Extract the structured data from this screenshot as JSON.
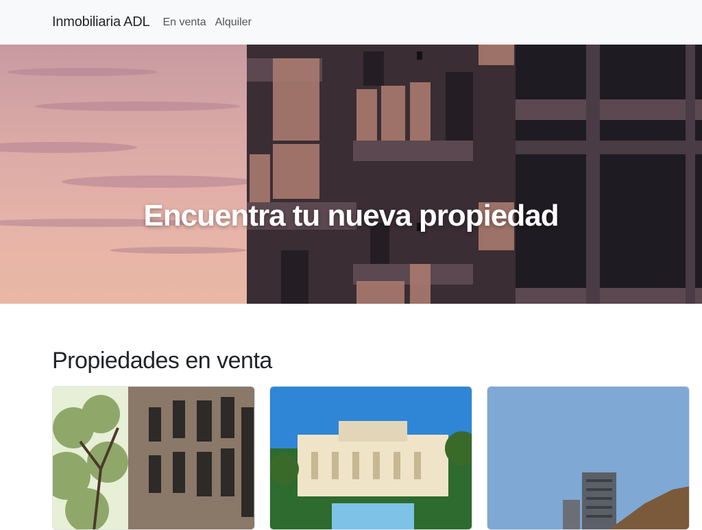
{
  "navbar": {
    "brand": "Inmobiliaria ADL",
    "links": [
      {
        "label": "En venta"
      },
      {
        "label": "Alquiler"
      }
    ]
  },
  "hero": {
    "title": "Encuentra tu nueva propiedad"
  },
  "properties_section": {
    "title": "Propiedades en venta",
    "cards": [
      {
        "image": "brownstone-townhouses-photo"
      },
      {
        "image": "mansion-with-pool-photo"
      },
      {
        "image": "coastal-towers-photo"
      }
    ]
  },
  "colors": {
    "navbar_bg": "#f8f9fa",
    "hero_sky": "#e6b3a8",
    "text": "#212529"
  }
}
